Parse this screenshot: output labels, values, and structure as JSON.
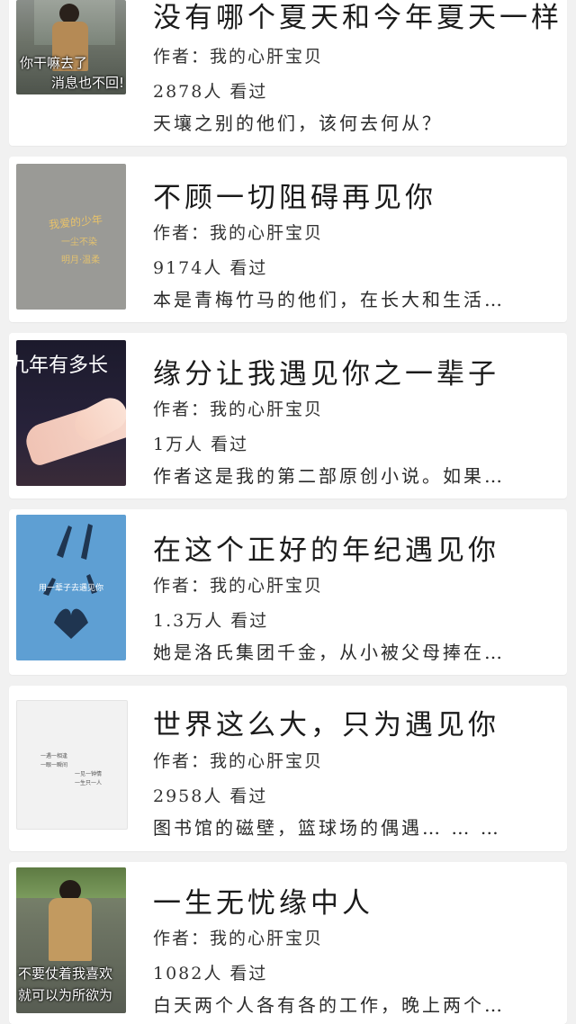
{
  "books": [
    {
      "title": "没有哪个夏天和今年夏天一样",
      "author": "作者：我的心肝宝贝",
      "views": "2878人 看过",
      "desc": "天壤之别的他们，该何去何从？",
      "cover": {
        "caption1": "你干嘛去了",
        "caption2": "消息也不回!"
      }
    },
    {
      "title": "不顾一切阻碍再见你",
      "author": "作者：我的心肝宝贝",
      "views": "9174人 看过",
      "desc": "本是青梅竹马的他们，在长大和生活…",
      "cover": {
        "line1": "我爱的少年",
        "line2": "一尘不染",
        "line3": "明月·温柔"
      }
    },
    {
      "title": "缘分让我遇见你之一辈子",
      "author": "作者：我的心肝宝贝",
      "views": "1万人 看过",
      "desc": "作者这是我的第二部原创小说。如果…",
      "cover": {
        "headline": "九年有多长"
      }
    },
    {
      "title": "在这个正好的年纪遇见你",
      "author": "作者：我的心肝宝贝",
      "views": "1.3万人 看过",
      "desc": "她是洛氏集团千金，从小被父母捧在…",
      "cover": {
        "band": "用一辈子去遇见你"
      }
    },
    {
      "title": "世界这么大，只为遇见你",
      "author": "作者：我的心肝宝贝",
      "views": "2958人 看过",
      "desc": "图书馆的磁壁，篮球场的偶遇… … …",
      "cover": {
        "l1": "一遇一相逢",
        "l2": "一眼一瞬间",
        "l3": "一见一钟情",
        "l4": "一生只一人"
      }
    },
    {
      "title": "一生无忧缘中人",
      "author": "作者：我的心肝宝贝",
      "views": "1082人 看过",
      "desc": "白天两个人各有各的工作，晚上两个…",
      "cover": {
        "caption1": "不要仗着我喜欢",
        "caption2": "就可以为所欲为"
      }
    }
  ],
  "colors": {
    "page_bg": "#f1f1f1",
    "card_bg": "#ffffff",
    "text": "#1b1b1b"
  }
}
